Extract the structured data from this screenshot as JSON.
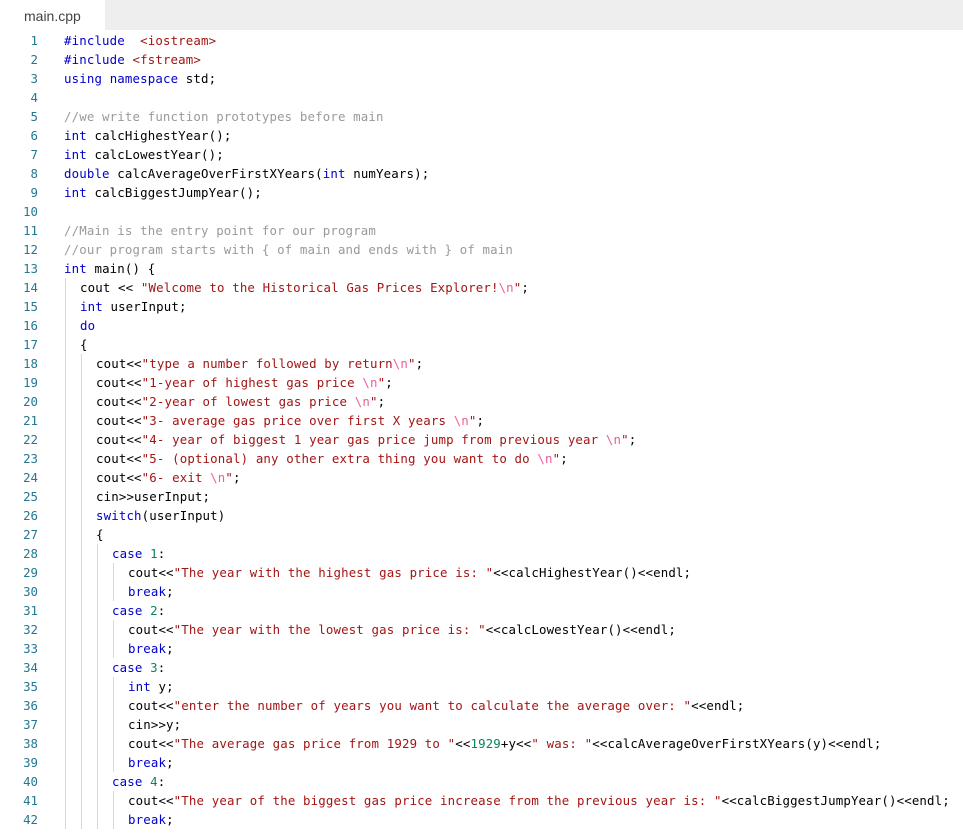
{
  "tab": {
    "label": "main.cpp"
  },
  "colors": {
    "keyword": "#0000cc",
    "string": "#a31515",
    "escape": "#ee5c9a",
    "comment": "#9a9a9a",
    "number": "#098658",
    "line_number": "#237893"
  },
  "lines": [
    {
      "n": "1",
      "indent": 0,
      "tokens": [
        [
          "kw",
          "#include"
        ],
        [
          "",
          "  "
        ],
        [
          "str",
          "<iostream>"
        ]
      ]
    },
    {
      "n": "2",
      "indent": 0,
      "tokens": [
        [
          "kw",
          "#include"
        ],
        [
          "",
          ""
        ],
        [
          "str",
          " <fstream>"
        ]
      ]
    },
    {
      "n": "3",
      "indent": 0,
      "tokens": [
        [
          "kw",
          "using"
        ],
        [
          "",
          " "
        ],
        [
          "kw",
          "namespace"
        ],
        [
          "",
          " std;"
        ]
      ]
    },
    {
      "n": "4",
      "indent": 0,
      "tokens": []
    },
    {
      "n": "5",
      "indent": 0,
      "tokens": [
        [
          "cm",
          "//we write function prototypes before main"
        ]
      ]
    },
    {
      "n": "6",
      "indent": 0,
      "tokens": [
        [
          "kw",
          "int"
        ],
        [
          "",
          " calcHighestYear();"
        ]
      ]
    },
    {
      "n": "7",
      "indent": 0,
      "tokens": [
        [
          "kw",
          "int"
        ],
        [
          "",
          " calcLowestYear();"
        ]
      ]
    },
    {
      "n": "8",
      "indent": 0,
      "tokens": [
        [
          "kw",
          "double"
        ],
        [
          "",
          " calcAverageOverFirstXYears("
        ],
        [
          "kw",
          "int"
        ],
        [
          "",
          " numYears);"
        ]
      ]
    },
    {
      "n": "9",
      "indent": 0,
      "tokens": [
        [
          "kw",
          "int"
        ],
        [
          "",
          " calcBiggestJumpYear();"
        ]
      ]
    },
    {
      "n": "10",
      "indent": 0,
      "tokens": []
    },
    {
      "n": "11",
      "indent": 0,
      "tokens": [
        [
          "cm",
          "//Main is the entry point for our program"
        ]
      ]
    },
    {
      "n": "12",
      "indent": 0,
      "tokens": [
        [
          "cm",
          "//our program starts with { of main and ends with } of main"
        ]
      ]
    },
    {
      "n": "13",
      "indent": 0,
      "tokens": [
        [
          "kw",
          "int"
        ],
        [
          "",
          " main() {"
        ]
      ]
    },
    {
      "n": "14",
      "indent": 1,
      "tokens": [
        [
          "",
          "cout << "
        ],
        [
          "str",
          "\"Welcome to the Historical Gas Prices Explorer!"
        ],
        [
          "esc",
          "\\n"
        ],
        [
          "str",
          "\""
        ],
        [
          "",
          ";"
        ]
      ]
    },
    {
      "n": "15",
      "indent": 1,
      "tokens": [
        [
          "kw",
          "int"
        ],
        [
          "",
          " userInput;"
        ]
      ]
    },
    {
      "n": "16",
      "indent": 1,
      "tokens": [
        [
          "kw",
          "do"
        ]
      ]
    },
    {
      "n": "17",
      "indent": 1,
      "tokens": [
        [
          "",
          "{"
        ]
      ]
    },
    {
      "n": "18",
      "indent": 2,
      "tokens": [
        [
          "",
          "cout<<"
        ],
        [
          "str",
          "\"type a number followed by return"
        ],
        [
          "esc",
          "\\n"
        ],
        [
          "str",
          "\""
        ],
        [
          "",
          ";"
        ]
      ]
    },
    {
      "n": "19",
      "indent": 2,
      "tokens": [
        [
          "",
          "cout<<"
        ],
        [
          "str",
          "\"1-year of highest gas price "
        ],
        [
          "esc",
          "\\n"
        ],
        [
          "str",
          "\""
        ],
        [
          "",
          ";"
        ]
      ]
    },
    {
      "n": "20",
      "indent": 2,
      "tokens": [
        [
          "",
          "cout<<"
        ],
        [
          "str",
          "\"2-year of lowest gas price "
        ],
        [
          "esc",
          "\\n"
        ],
        [
          "str",
          "\""
        ],
        [
          "",
          ";"
        ]
      ]
    },
    {
      "n": "21",
      "indent": 2,
      "tokens": [
        [
          "",
          "cout<<"
        ],
        [
          "str",
          "\"3- average gas price over first X years "
        ],
        [
          "esc",
          "\\n"
        ],
        [
          "str",
          "\""
        ],
        [
          "",
          ";"
        ]
      ]
    },
    {
      "n": "22",
      "indent": 2,
      "tokens": [
        [
          "",
          "cout<<"
        ],
        [
          "str",
          "\"4- year of biggest 1 year gas price jump from previous year "
        ],
        [
          "esc",
          "\\n"
        ],
        [
          "str",
          "\""
        ],
        [
          "",
          ";"
        ]
      ]
    },
    {
      "n": "23",
      "indent": 2,
      "tokens": [
        [
          "",
          "cout<<"
        ],
        [
          "str",
          "\"5- (optional) any other extra thing you want to do "
        ],
        [
          "esc",
          "\\n"
        ],
        [
          "str",
          "\""
        ],
        [
          "",
          ";"
        ]
      ]
    },
    {
      "n": "24",
      "indent": 2,
      "tokens": [
        [
          "",
          "cout<<"
        ],
        [
          "str",
          "\"6- exit "
        ],
        [
          "esc",
          "\\n"
        ],
        [
          "str",
          "\""
        ],
        [
          "",
          ";"
        ]
      ]
    },
    {
      "n": "25",
      "indent": 2,
      "tokens": [
        [
          "",
          "cin>>userInput;"
        ]
      ]
    },
    {
      "n": "26",
      "indent": 2,
      "tokens": [
        [
          "kw",
          "switch"
        ],
        [
          "",
          "(userInput)"
        ]
      ]
    },
    {
      "n": "27",
      "indent": 2,
      "tokens": [
        [
          "",
          "{"
        ]
      ]
    },
    {
      "n": "28",
      "indent": 3,
      "tokens": [
        [
          "kw",
          "case"
        ],
        [
          "",
          " "
        ],
        [
          "num",
          "1"
        ],
        [
          "",
          ":"
        ]
      ]
    },
    {
      "n": "29",
      "indent": 4,
      "tokens": [
        [
          "",
          "cout<<"
        ],
        [
          "str",
          "\"The year with the highest gas price is: \""
        ],
        [
          "",
          "<<calcHighestYear()<<endl;"
        ]
      ]
    },
    {
      "n": "30",
      "indent": 4,
      "tokens": [
        [
          "kw",
          "break"
        ],
        [
          "",
          ";"
        ]
      ]
    },
    {
      "n": "31",
      "indent": 3,
      "tokens": [
        [
          "kw",
          "case"
        ],
        [
          "",
          " "
        ],
        [
          "num",
          "2"
        ],
        [
          "",
          ":"
        ]
      ]
    },
    {
      "n": "32",
      "indent": 4,
      "tokens": [
        [
          "",
          "cout<<"
        ],
        [
          "str",
          "\"The year with the lowest gas price is: \""
        ],
        [
          "",
          "<<calcLowestYear()<<endl;"
        ]
      ]
    },
    {
      "n": "33",
      "indent": 4,
      "tokens": [
        [
          "kw",
          "break"
        ],
        [
          "",
          ";"
        ]
      ]
    },
    {
      "n": "34",
      "indent": 3,
      "tokens": [
        [
          "kw",
          "case"
        ],
        [
          "",
          " "
        ],
        [
          "num",
          "3"
        ],
        [
          "",
          ":"
        ]
      ]
    },
    {
      "n": "35",
      "indent": 4,
      "tokens": [
        [
          "kw",
          "int"
        ],
        [
          "",
          " y;"
        ]
      ]
    },
    {
      "n": "36",
      "indent": 4,
      "tokens": [
        [
          "",
          "cout<<"
        ],
        [
          "str",
          "\"enter the number of years you want to calculate the average over: \""
        ],
        [
          "",
          "<<endl;"
        ]
      ]
    },
    {
      "n": "37",
      "indent": 4,
      "tokens": [
        [
          "",
          "cin>>y;"
        ]
      ]
    },
    {
      "n": "38",
      "indent": 4,
      "tokens": [
        [
          "",
          "cout<<"
        ],
        [
          "str",
          "\"The average gas price from 1929 to \""
        ],
        [
          "",
          "<<"
        ],
        [
          "num",
          "1929"
        ],
        [
          "",
          "+y<<"
        ],
        [
          "str",
          "\" was: \""
        ],
        [
          "",
          "<<calcAverageOverFirstXYears(y)<<endl;"
        ]
      ]
    },
    {
      "n": "39",
      "indent": 4,
      "tokens": [
        [
          "kw",
          "break"
        ],
        [
          "",
          ";"
        ]
      ]
    },
    {
      "n": "40",
      "indent": 3,
      "tokens": [
        [
          "kw",
          "case"
        ],
        [
          "",
          " "
        ],
        [
          "num",
          "4"
        ],
        [
          "",
          ":"
        ]
      ]
    },
    {
      "n": "41",
      "indent": 4,
      "tokens": [
        [
          "",
          "cout<<"
        ],
        [
          "str",
          "\"The year of the biggest gas price increase from the previous year is: \""
        ],
        [
          "",
          "<<calcBiggestJumpYear()<<endl;"
        ]
      ]
    },
    {
      "n": "42",
      "indent": 4,
      "tokens": [
        [
          "kw",
          "break"
        ],
        [
          "",
          ";"
        ]
      ]
    }
  ]
}
